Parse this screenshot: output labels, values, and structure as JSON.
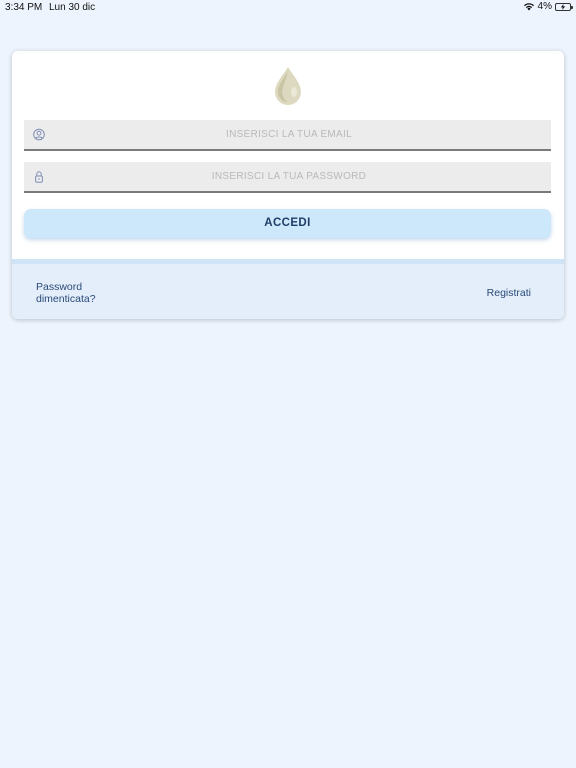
{
  "status_bar": {
    "time": "3:34 PM",
    "date": "Lun 30 dic",
    "battery": "4%",
    "wifi_icon": "wifi-icon",
    "battery_icon": "battery-charging-icon"
  },
  "login": {
    "logo_icon": "water-drop-icon",
    "email": {
      "icon": "user-icon",
      "value": "",
      "placeholder": "INSERISCI LA TUA EMAIL"
    },
    "password": {
      "icon": "lock-icon",
      "value": "",
      "placeholder": "INSERISCI LA TUA PASSWORD"
    },
    "submit_label": "ACCEDI",
    "forgot_password_label": "Password dimenticata?",
    "register_label": "Registrati"
  },
  "colors": {
    "background": "#eef4fd",
    "button_bg": "#cde7fb",
    "button_text": "#1e3e68",
    "footer_bg": "#e3eefa",
    "link_text": "#2a4a78",
    "field_bg": "#ececec"
  }
}
